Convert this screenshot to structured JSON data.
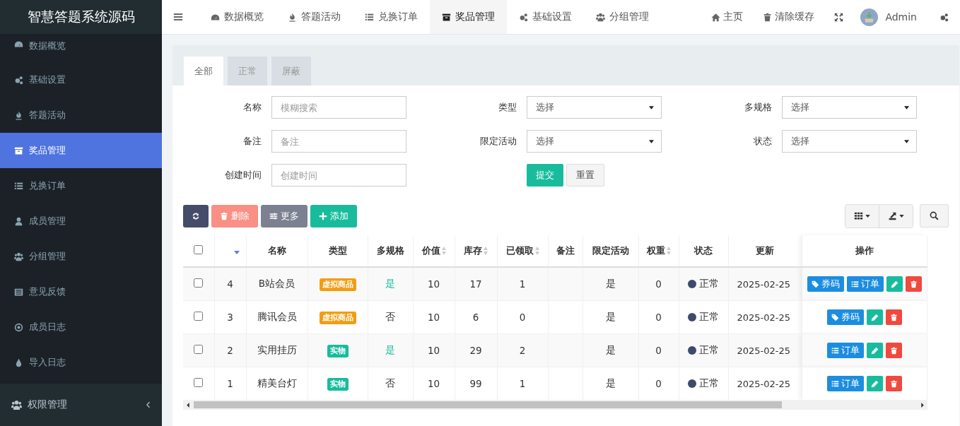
{
  "app_title": "智慧答题系统源码",
  "sidebar": {
    "items": [
      {
        "label": "数据概览",
        "selected": false
      },
      {
        "label": "基础设置",
        "selected": false
      },
      {
        "label": "答题活动",
        "selected": false
      },
      {
        "label": "奖品管理",
        "selected": true
      },
      {
        "label": "兑换订单",
        "selected": false
      },
      {
        "label": "成员管理",
        "selected": false
      },
      {
        "label": "分组管理",
        "selected": false
      },
      {
        "label": "意见反馈",
        "selected": false
      },
      {
        "label": "成员日志",
        "selected": false
      },
      {
        "label": "导入日志",
        "selected": false
      }
    ],
    "footer": {
      "label": "权限管理"
    }
  },
  "topnav": {
    "items": [
      {
        "label": "数据概览",
        "selected": false
      },
      {
        "label": "答题活动",
        "selected": false
      },
      {
        "label": "兑换订单",
        "selected": false
      },
      {
        "label": "奖品管理",
        "selected": true
      },
      {
        "label": "基础设置",
        "selected": false
      },
      {
        "label": "分组管理",
        "selected": false
      }
    ],
    "right": [
      {
        "label": "主页"
      },
      {
        "label": "清除缓存"
      }
    ],
    "user": "Admin"
  },
  "tabs": [
    {
      "label": "全部",
      "selected": true
    },
    {
      "label": "正常",
      "selected": false
    },
    {
      "label": "屏蔽",
      "selected": false
    }
  ],
  "filters": [
    {
      "kind": "text",
      "label": "名称",
      "placeholder": "模糊搜索"
    },
    {
      "kind": "select",
      "label": "类型",
      "value": "选择"
    },
    {
      "kind": "select",
      "label": "多规格",
      "value": "选择"
    },
    {
      "kind": "text",
      "label": "备注",
      "placeholder": "备注"
    },
    {
      "kind": "select",
      "label": "限定活动",
      "value": "选择"
    },
    {
      "kind": "select",
      "label": "状态",
      "value": "选择"
    },
    {
      "kind": "text",
      "label": "创建时间",
      "placeholder": "创建时间"
    },
    {
      "kind": "buttons",
      "buttons": [
        "提交",
        "重置"
      ]
    }
  ],
  "toolbar": [
    {
      "kind": "refresh",
      "disabled": false
    },
    {
      "kind": "delete",
      "label": "删除",
      "disabled": true
    },
    {
      "kind": "more",
      "label": "更多",
      "disabled": false
    },
    {
      "kind": "add",
      "label": "添加",
      "disabled": false
    }
  ],
  "table": {
    "select_all_checked": false,
    "columns": [
      "名称",
      "类型",
      "多规格",
      "价值",
      "库存",
      "已领取",
      "备注",
      "限定活动",
      "权重",
      "状态",
      "更新",
      "操作"
    ],
    "rows": [
      {
        "checked": false,
        "id": "4",
        "name": "B站会员",
        "type": {
          "kind": "virtual",
          "label": "虚拟商品"
        },
        "multi": {
          "yes": true,
          "label": "是"
        },
        "value": "10",
        "stock": "17",
        "claimed": "1",
        "limited": "是",
        "weight": "0",
        "status": {
          "label": "正常",
          "color": "#3d4a6b"
        },
        "updated": "2025-02-25",
        "actions": [
          {
            "kind": "coupon",
            "label": "券码"
          },
          {
            "kind": "order",
            "label": "订单"
          },
          {
            "kind": "edit"
          },
          {
            "kind": "delete"
          }
        ]
      },
      {
        "checked": false,
        "id": "3",
        "name": "腾讯会员",
        "type": {
          "kind": "virtual",
          "label": "虚拟商品"
        },
        "multi": {
          "yes": false,
          "label": "否"
        },
        "value": "10",
        "stock": "6",
        "claimed": "0",
        "limited": "是",
        "weight": "0",
        "status": {
          "label": "正常",
          "color": "#3d4a6b"
        },
        "updated": "2025-02-25",
        "actions": [
          {
            "kind": "coupon",
            "label": "券码"
          },
          {
            "kind": "edit"
          },
          {
            "kind": "delete"
          }
        ]
      },
      {
        "checked": false,
        "id": "2",
        "name": "实用挂历",
        "type": {
          "kind": "physical",
          "label": "实物"
        },
        "multi": {
          "yes": true,
          "label": "是"
        },
        "value": "10",
        "stock": "29",
        "claimed": "2",
        "limited": "是",
        "weight": "0",
        "status": {
          "label": "正常",
          "color": "#3d4a6b"
        },
        "updated": "2025-02-25",
        "actions": [
          {
            "kind": "order",
            "label": "订单"
          },
          {
            "kind": "edit"
          },
          {
            "kind": "delete"
          }
        ]
      },
      {
        "checked": false,
        "id": "1",
        "name": "精美台灯",
        "type": {
          "kind": "physical",
          "label": "实物"
        },
        "multi": {
          "yes": false,
          "label": "否"
        },
        "value": "10",
        "stock": "99",
        "claimed": "1",
        "limited": "是",
        "weight": "0",
        "status": {
          "label": "正常",
          "color": "#3d4a6b"
        },
        "updated": "2025-02-25",
        "actions": [
          {
            "kind": "order",
            "label": "订单"
          },
          {
            "kind": "edit"
          },
          {
            "kind": "delete"
          }
        ]
      }
    ]
  }
}
